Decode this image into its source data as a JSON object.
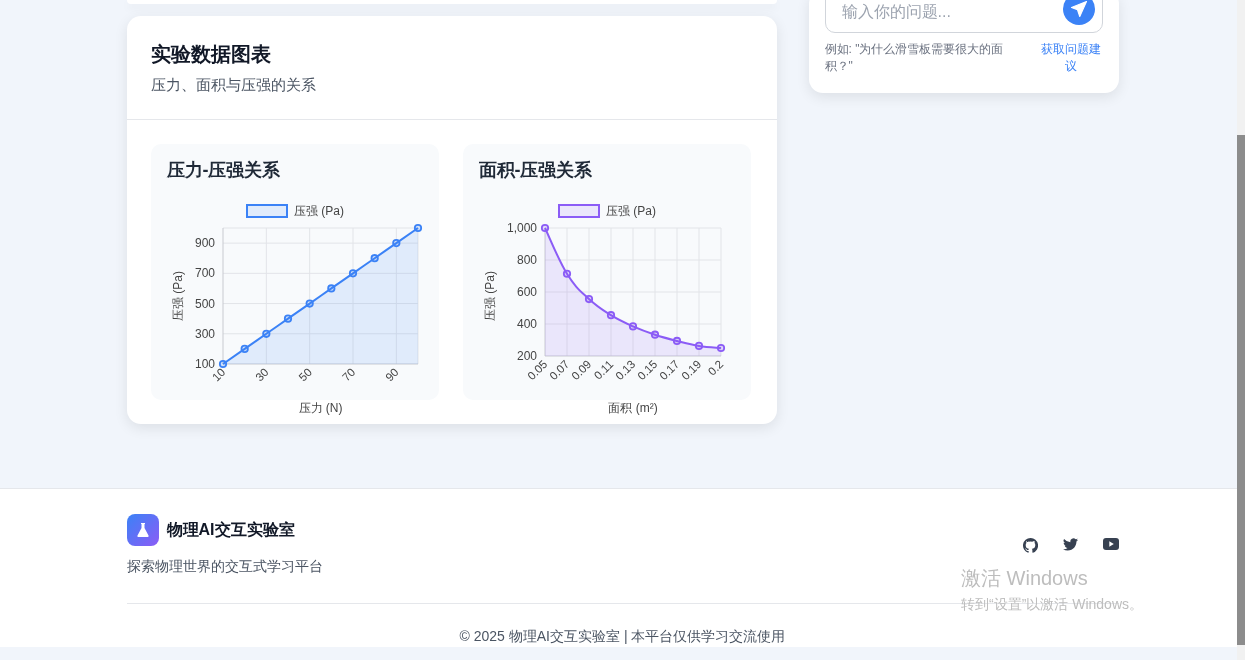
{
  "chart_card": {
    "title": "实验数据图表",
    "subtitle": "压力、面积与压强的关系",
    "charts": [
      {
        "title": "压力-压强关系",
        "chart_data": {
          "type": "area",
          "xlabel": "压力 (N)",
          "ylabel": "压强 (Pa)",
          "x": [
            10,
            20,
            30,
            40,
            50,
            60,
            70,
            80,
            90,
            100
          ],
          "xlim": [
            10,
            100
          ],
          "grid": true,
          "series": [
            {
              "name": "压强 (Pa)",
              "color": "#3b82f6",
              "values": [
                100,
                200,
                300,
                400,
                500,
                600,
                700,
                800,
                900,
                1000
              ]
            }
          ],
          "ylim": [
            100,
            1000
          ],
          "xticks": [
            10,
            30,
            50,
            70,
            90
          ],
          "yticks": [
            100,
            300,
            500,
            700,
            900
          ]
        }
      },
      {
        "title": "面积-压强关系",
        "chart_data": {
          "type": "area",
          "xlabel": "面积 (m²)",
          "ylabel": "压强 (Pa)",
          "grid": true,
          "categories": [
            "0.05",
            "0.07",
            "0.09",
            "0.11",
            "0.13",
            "0.15",
            "0.17",
            "0.19",
            "0.2"
          ],
          "series": [
            {
              "name": "压强 (Pa)",
              "color": "#8b5cf6",
              "values": [
                1000,
                714,
                556,
                455,
                385,
                333,
                294,
                263,
                250
              ]
            }
          ],
          "ylim": [
            200,
            1000
          ],
          "yticks": [
            200,
            400,
            600,
            800,
            {
              "value": 1000,
              "label": "1,000"
            }
          ]
        }
      }
    ]
  },
  "ask_panel": {
    "placeholder": "输入你的问题...",
    "example": "例如: \"为什么滑雪板需要很大的面积？\"",
    "suggest_link": "获取问题建议"
  },
  "footer": {
    "brand": "物理AI交互实验室",
    "tagline": "探索物理世界的交互式学习平台",
    "social": [
      {
        "kind": "github"
      },
      {
        "kind": "twitter"
      },
      {
        "kind": "youtube"
      }
    ],
    "copyright": "© 2025 物理AI交互实验室 | 本平台仅供学习交流使用"
  },
  "os_overlay": {
    "title": "激活 Windows",
    "text": "转到“设置”以激活 Windows。"
  }
}
